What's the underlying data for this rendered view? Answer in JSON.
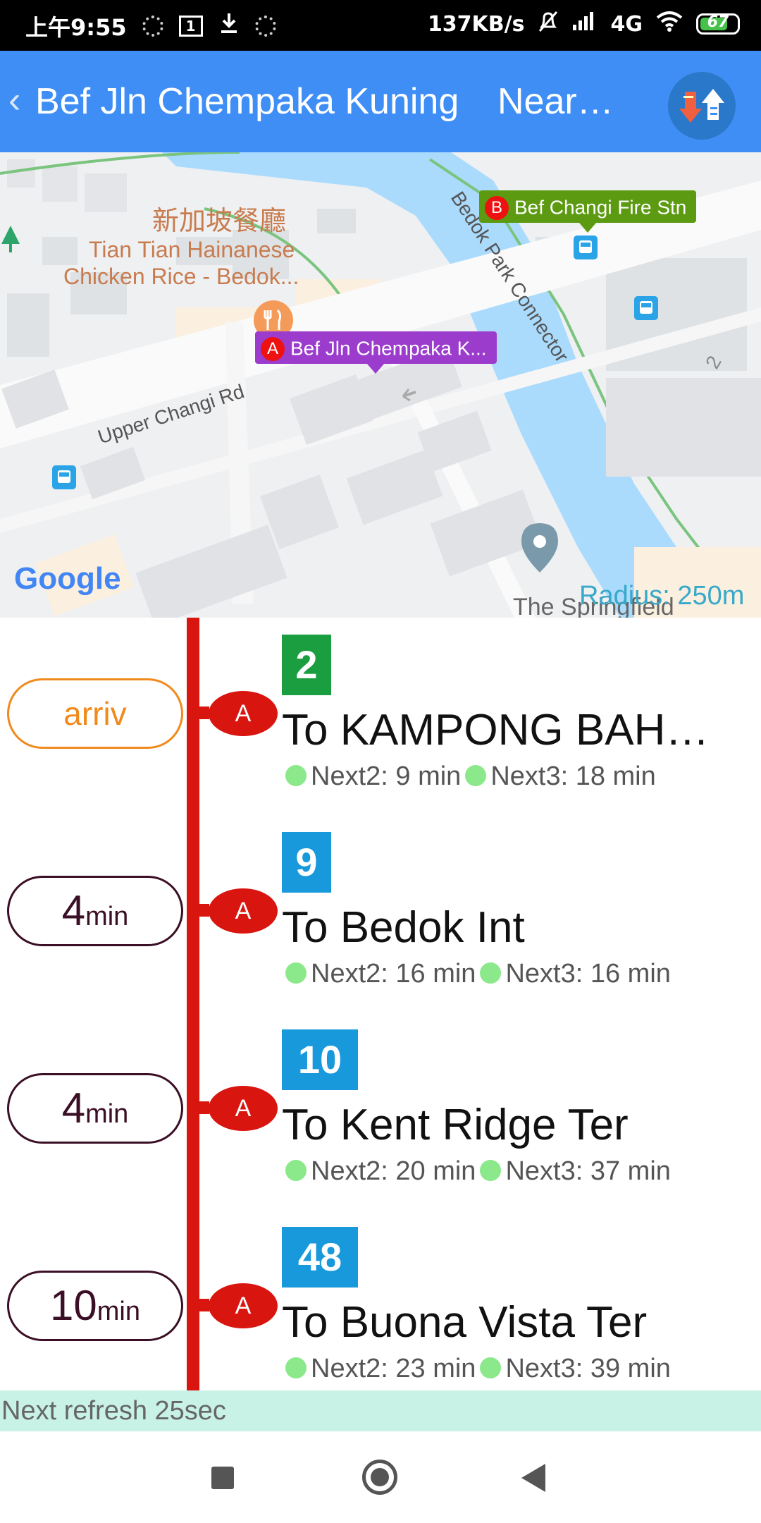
{
  "status_bar": {
    "time": "上午9:55",
    "net_speed": "137KB/s",
    "network": "4G",
    "battery": "67",
    "sim_badge": "1"
  },
  "app_bar": {
    "back_icon": "chevron-left-icon",
    "title": "Bef Jln Chempaka Kuning",
    "nearby": "Nearby stops",
    "sort_icon": "sort-arrows-icon"
  },
  "map": {
    "pin_a": {
      "letter": "A",
      "label": "Bef Jln Chempaka K..."
    },
    "pin_b": {
      "letter": "B",
      "label": "Bef Changi Fire Stn"
    },
    "restaurant_cn": "新加坡餐廳",
    "restaurant_en_1": "Tian Tian Hainanese",
    "restaurant_en_2": "Chicken Rice -  Bedok...",
    "road_1": "Upper Changi Rd",
    "road_2": "Bedok Park Connector",
    "place": "The Springfield",
    "radius": "Radius: 250m",
    "logo": "Google",
    "map_number": "2"
  },
  "services": [
    {
      "bus": "2",
      "color": "#1a9e3f",
      "eta_value": "arriv",
      "eta_unit": "",
      "eta_style": "arrive",
      "stop": "A",
      "dest": "To KAMPONG BAHRU TER",
      "next2": "Next2: 9 min",
      "next3": "Next3: 18 min"
    },
    {
      "bus": "9",
      "color": "#1799dc",
      "eta_value": "4",
      "eta_unit": "min",
      "eta_style": "min",
      "stop": "A",
      "dest": "To Bedok Int",
      "next2": "Next2: 16 min",
      "next3": "Next3: 16 min"
    },
    {
      "bus": "10",
      "color": "#1799dc",
      "eta_value": "4",
      "eta_unit": "min",
      "eta_style": "min",
      "stop": "A",
      "dest": "To Kent Ridge Ter",
      "next2": "Next2: 20 min",
      "next3": "Next3: 37 min"
    },
    {
      "bus": "48",
      "color": "#1799dc",
      "eta_value": "10",
      "eta_unit": "min",
      "eta_style": "min",
      "stop": "A",
      "dest": "To Buona Vista Ter",
      "next2": "Next2: 23 min",
      "next3": "Next3: 39 min"
    }
  ],
  "refresh_text": "Next refresh 25sec",
  "nav": {
    "recents_icon": "square-icon",
    "home_icon": "circle-home-icon",
    "back_icon": "triangle-back-icon"
  }
}
